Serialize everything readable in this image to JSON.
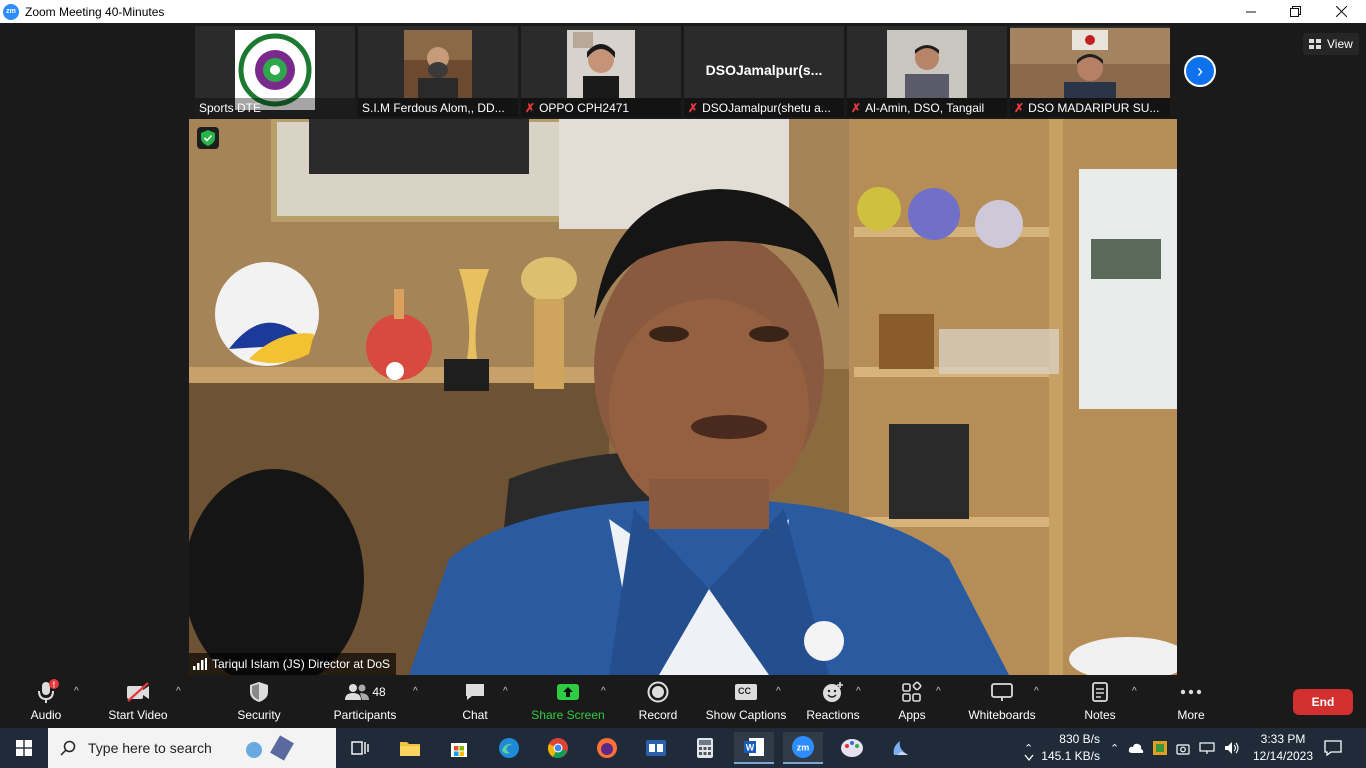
{
  "window": {
    "title": "Zoom Meeting 40-Minutes",
    "logo_text": "zm",
    "controls": [
      "minimize",
      "restore",
      "close"
    ]
  },
  "view_button": {
    "label": "View"
  },
  "thumbnails": [
    {
      "name": "Sports DTE",
      "muted": false,
      "has_video": true,
      "image": "directorate-of-sports-logo"
    },
    {
      "name": "S.I.M Ferdous Alom,, DD...",
      "muted": false,
      "has_video": true,
      "image": "participant-video"
    },
    {
      "name": "OPPO CPH2471",
      "muted": true,
      "has_video": true,
      "image": "participant-video"
    },
    {
      "name": "DSOJamalpur(shetu a...",
      "muted": true,
      "has_video": false,
      "display_name": "DSOJamalpur(s..."
    },
    {
      "name": "Al-Amin, DSO, Tangail",
      "muted": true,
      "has_video": true,
      "image": "participant-video"
    },
    {
      "name": "DSO MADARIPUR SU...",
      "muted": true,
      "has_video": true,
      "image": "participant-video"
    }
  ],
  "speaker": {
    "name": "Tariqul Islam (JS) Director at DoS"
  },
  "toolbar": {
    "audio": "Audio",
    "start_video": "Start Video",
    "security": "Security",
    "participants": "Participants",
    "participants_count": "48",
    "chat": "Chat",
    "share_screen": "Share Screen",
    "record": "Record",
    "show_captions": "Show Captions",
    "reactions": "Reactions",
    "apps": "Apps",
    "whiteboards": "Whiteboards",
    "notes": "Notes",
    "more": "More",
    "end": "End",
    "cc_text": "CC"
  },
  "taskbar": {
    "search_placeholder": "Type here to search",
    "net_up": "830 B/s",
    "net_down": "145.1 KB/s",
    "time": "3:33 PM",
    "date": "12/14/2023"
  },
  "colors": {
    "zoom_blue": "#2d8cff",
    "share_green": "#2ecc40",
    "end_red": "#d32f2f",
    "mute_red": "#e5393d"
  }
}
